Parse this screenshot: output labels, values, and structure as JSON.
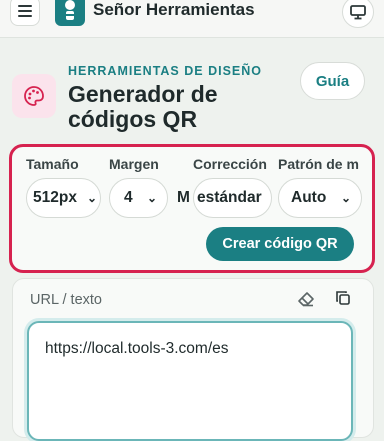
{
  "header": {
    "brand": "Señor Herramientas",
    "menu_icon": "menu-icon",
    "logo_icon": "logo-icon",
    "display_icon": "monitor-icon"
  },
  "hero": {
    "eyebrow": "HERRAMIENTAS DE DISEÑO",
    "title": "Generador de códigos QR",
    "guide_label": "Guía",
    "icon": "palette-icon"
  },
  "controls": {
    "size": {
      "label": "Tamaño",
      "value": "512px"
    },
    "margin": {
      "label": "Margen",
      "value": "4"
    },
    "extra": {
      "value": "M"
    },
    "correction": {
      "label": "Corrección",
      "value": "estándar"
    },
    "pattern": {
      "label": "Patrón de m",
      "value": "Auto"
    },
    "create_label": "Crear código QR"
  },
  "input": {
    "label": "URL / texto",
    "value": "https://local.tools-3.com/es",
    "clear_icon": "eraser-icon",
    "copy_icon": "copy-icon"
  },
  "colors": {
    "accent": "#1b7f83",
    "highlight_border": "#d6224f",
    "icon_bg": "#fbe3ec"
  }
}
